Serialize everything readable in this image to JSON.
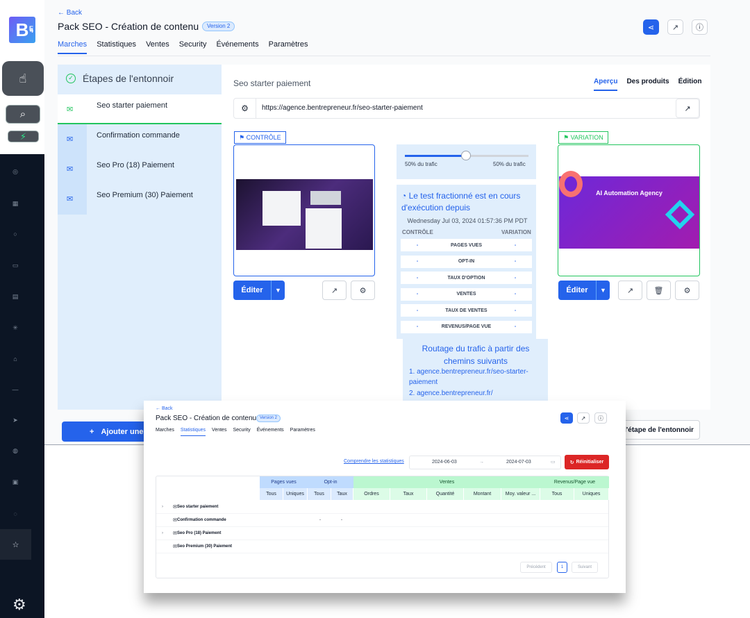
{
  "header": {
    "back": "← Back",
    "title": "Pack SEO - Création de contenu",
    "version": "Version 2",
    "tabs": [
      "Marches",
      "Statistiques",
      "Ventes",
      "Security",
      "Événements",
      "Paramètres"
    ]
  },
  "funnel": {
    "title": "Étapes de l'entonnoir",
    "steps": [
      "Seo starter paiement",
      "Confirmation commande",
      "Seo Pro (18) Paiement",
      "Seo Premium (30) Paiement"
    ],
    "add_label": "Ajouter une"
  },
  "page": {
    "name": "Seo starter paiement",
    "view_tabs": [
      "Aperçu",
      "Des produits",
      "Édition"
    ],
    "url": "https://agence.bentrepreneur.fr/seo-starter-paiement",
    "control_tag": "CONTRÔLE",
    "variation_tag": "VARIATION",
    "variation_preview_title": "AI Automation Agency",
    "edit_label": "Éditer",
    "add_step": "l'étape de l'entonnoir"
  },
  "split": {
    "traffic_left": "50% du trafic",
    "traffic_right": "50% du trafic",
    "traffic_pct": 50,
    "status": "Le test fractionné est en cours d'exécution depuis",
    "date": "Wednesday Jul 03, 2024 01:57:36 PM PDT",
    "col_control": "CONTRÔLE",
    "col_variation": "VARIATION",
    "metrics": [
      {
        "label": "PAGES VUES",
        "c": "-",
        "v": "-"
      },
      {
        "label": "OPT-IN",
        "c": "-",
        "v": "-"
      },
      {
        "label": "TAUX D'OPTION",
        "c": "-",
        "v": "-"
      },
      {
        "label": "VENTES",
        "c": "-",
        "v": "-"
      },
      {
        "label": "TAUX DE VENTES",
        "c": "-",
        "v": "-"
      },
      {
        "label": "REVENUS/PAGE VUE",
        "c": "-",
        "v": "-"
      }
    ],
    "routing_title": "Routage du trafic à partir des chemins suivants",
    "routes": [
      "1. agence.bentrepreneur.fr/seo-starter-paiement",
      "2. agence.bentrepreneur.fr/"
    ]
  },
  "stats": {
    "back": "← Back",
    "title": "Pack SEO - Création de contenu",
    "version": "Version 2",
    "tabs": [
      "Marches",
      "Statistiques",
      "Ventes",
      "Security",
      "Événements",
      "Paramètres"
    ],
    "link": "Comprendre les statistiques",
    "date_from": "2024-06-03",
    "date_to": "2024-07-03",
    "arrow": "→",
    "reset": "Réinitialiser",
    "groups": [
      "Pages vues",
      "Opt-in",
      "Ventes",
      "Revenus/Page vue"
    ],
    "subheaders": [
      "Tous",
      "Uniques",
      "Tous",
      "Taux",
      "Ordres",
      "Taux",
      "Quantité",
      "Montant",
      "Moy. valeur ...",
      "Tous",
      "Uniques"
    ],
    "rows": [
      "Seo starter paiement",
      "Confirmation commande",
      "Seo Pro (18) Paiement",
      "Seo Premium (30) Paiement"
    ],
    "dash": "-",
    "prev": "Précédent",
    "page": "1",
    "next": "Suivant"
  }
}
